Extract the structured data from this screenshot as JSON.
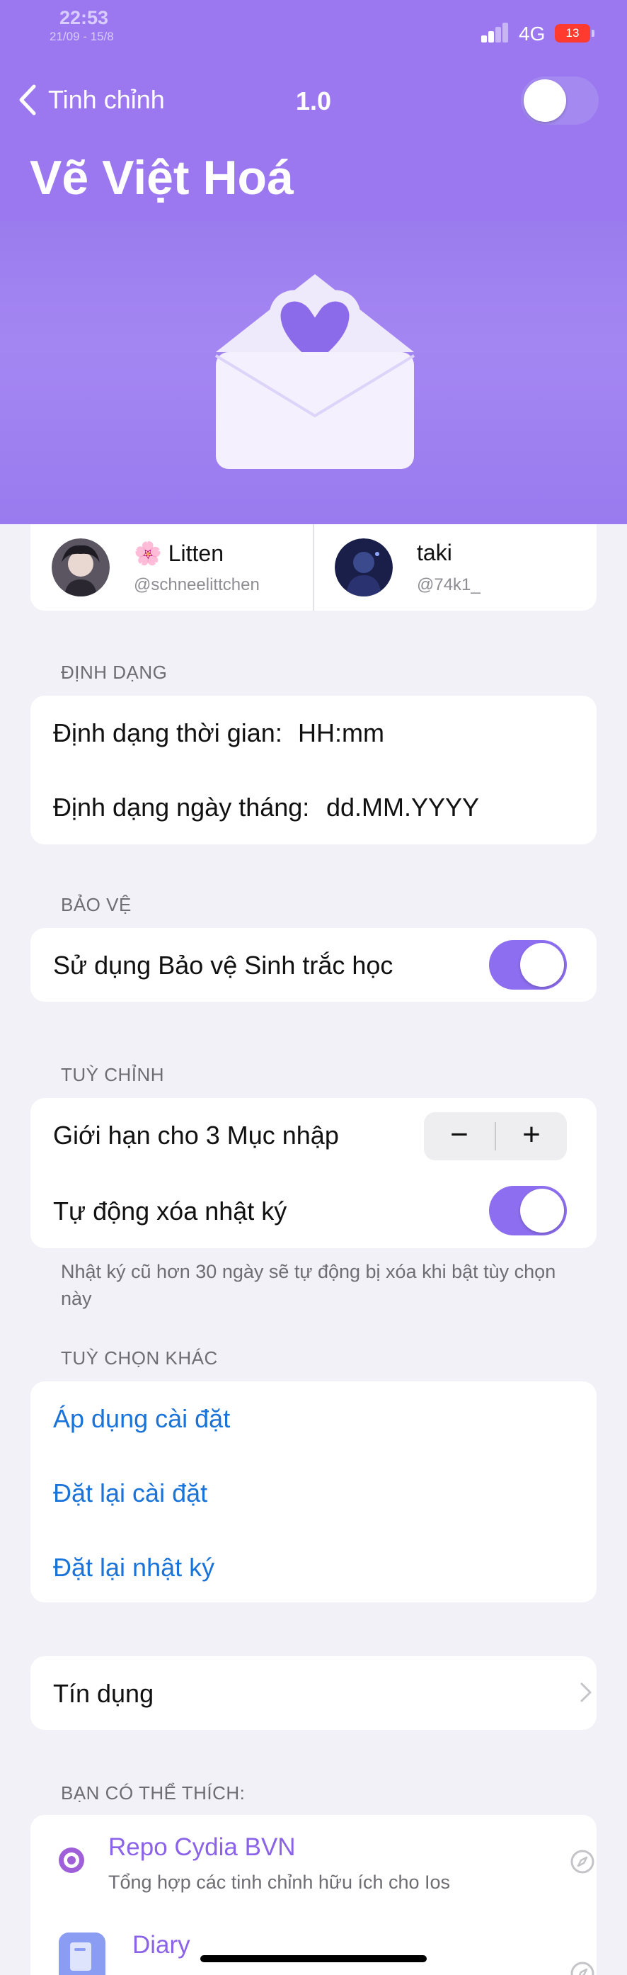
{
  "status_bar": {
    "time": "22:53",
    "date": "21/09 - 15/8",
    "network": "4G",
    "battery": "13"
  },
  "nav": {
    "back_label": "Tinh chỉnh",
    "version": "1.0",
    "title": "Vẽ Việt Hoá"
  },
  "authors": [
    {
      "name": "🌸 Litten",
      "handle": "@schneelittchen"
    },
    {
      "name": "taki",
      "handle": "@74k1_"
    }
  ],
  "sections": {
    "format": {
      "header": "ĐỊNH DẠNG",
      "time_label": "Định dạng thời gian:",
      "time_value": "HH:mm",
      "date_label": "Định dạng ngày tháng:",
      "date_value": "dd.MM.YYYY"
    },
    "security": {
      "header": "BẢO VỆ",
      "biometric_label": "Sử dụng Bảo vệ Sinh trắc học",
      "biometric_on": true
    },
    "custom": {
      "header": "TUỲ CHỈNH",
      "limit_label": "Giới hạn cho 3 Mục nhập",
      "minus": "−",
      "plus": "+",
      "autodelete_label": "Tự động xóa nhật ký",
      "autodelete_on": true,
      "note": "Nhật ký cũ hơn 30 ngày sẽ tự động bị xóa khi bật tùy chọn này"
    },
    "other": {
      "header": "TUỲ CHỌN KHÁC",
      "apply": "Áp dụng cài đặt",
      "reset_settings": "Đặt lại cài đặt",
      "reset_log": "Đặt lại nhật ký"
    },
    "credits": {
      "label": "Tín dụng"
    },
    "suggest": {
      "header": "BẠN CÓ THỂ THÍCH:",
      "items": [
        {
          "name": "Repo Cydia BVN",
          "desc": "Tổng hợp các tinh chỉnh hữu ích cho Ios",
          "icon": "repo-icon"
        },
        {
          "name": "Diary",
          "desc": "",
          "icon": "diary-icon"
        }
      ]
    }
  },
  "colors": {
    "accent": "#9b78f0",
    "toggle_on": "#8d6ef0",
    "link": "#1a73d9",
    "battery_low": "#ff3b30"
  }
}
